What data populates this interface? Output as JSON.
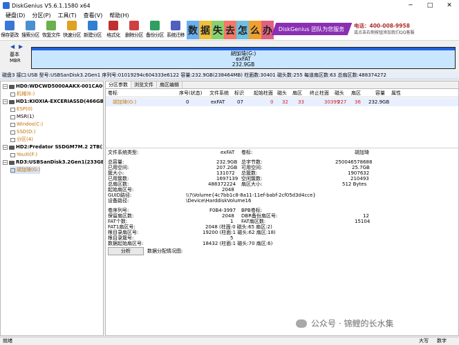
{
  "window": {
    "title": "DiskGenius V5.6.1.1580 x64",
    "minimize": "─",
    "maximize": "□",
    "close": "✕"
  },
  "menu": [
    "硬盘(D)",
    "分区(P)",
    "工具(T)",
    "查看(V)",
    "帮助(H)"
  ],
  "toolbar": [
    {
      "label": "保存更改",
      "icon": "save-icon",
      "color": "#3a78d8"
    },
    {
      "label": "搜索分区",
      "icon": "search-partition-icon",
      "color": "#4a90d0"
    },
    {
      "label": "恢复文件",
      "icon": "recover-files-icon",
      "color": "#6ab04c"
    },
    {
      "label": "快速分区",
      "icon": "quick-partition-icon",
      "color": "#e0a020"
    },
    {
      "label": "新建分区",
      "icon": "new-partition-icon",
      "color": "#2f80d0"
    },
    {
      "label": "格式化",
      "icon": "format-icon",
      "color": "#c03030"
    },
    {
      "label": "删除分区",
      "icon": "delete-partition-icon",
      "color": "#d04040"
    },
    {
      "label": "备份分区",
      "icon": "backup-partition-icon",
      "color": "#30a060"
    },
    {
      "label": "系统迁移",
      "icon": "system-migration-icon",
      "color": "#5060c0"
    }
  ],
  "banner": {
    "tiles": [
      {
        "char": "数",
        "color": "#6ab0f0"
      },
      {
        "char": "据",
        "color": "#f0c040"
      },
      {
        "char": "失",
        "color": "#8ad070"
      },
      {
        "char": "去",
        "color": "#f07a6a"
      },
      {
        "char": "怎",
        "color": "#70c0e0"
      },
      {
        "char": "么",
        "color": "#f0a030"
      },
      {
        "char": "办",
        "color": "#e06080"
      }
    ],
    "promo": "DiskGenius 团队为您服务",
    "phone": "电话：400-008-9958",
    "qq": "或点击右侧按钮添加我们QQ客服"
  },
  "diskmap": {
    "left_arrow": "◀",
    "right_arrow": "▶",
    "basic": "基本",
    "mbr": "MBR",
    "partition_name": "胡加琦(G:)",
    "partition_fs": "exFAT",
    "partition_size": "232.9GB"
  },
  "info_line": "磁盘3 接口:USB  型号:USBSanDisk3.2Gen1  序列号:01019294c604333e6122  容量:232.9GB(238464MB)  柱面数:30401  磁头数:255  每道扇区数:63  总扇区数:488374272",
  "tree": [
    {
      "label": "HD0:WDCWD5000AAKX-001CA0(466",
      "type": "disk",
      "bold": true
    },
    {
      "label": "机械(E:)",
      "type": "part"
    },
    {
      "label": "HD1:KIOXIA-EXCERIASSD(466GB)",
      "type": "disk",
      "bold": true
    },
    {
      "label": "ESP(0)",
      "type": "part"
    },
    {
      "label": "MSR(1)",
      "type": "part"
    },
    {
      "label": "Windos(C:)",
      "type": "part"
    },
    {
      "label": "SSD(D:)",
      "type": "part"
    },
    {
      "label": "分区(4)",
      "type": "part"
    },
    {
      "label": "HD2:Predator SSDGM7M.2 2TB(1908G",
      "type": "disk",
      "bold": true
    },
    {
      "label": "YouXi(F:)",
      "type": "part"
    },
    {
      "label": "RD3:USBSanDisk3.2Gen1(233GB)",
      "type": "disk",
      "bold": true
    },
    {
      "label": "胡加琦(G:)",
      "type": "part"
    }
  ],
  "tabs": [
    "分区参数",
    "浏览文件",
    "扇区编辑"
  ],
  "table": {
    "headers": [
      "卷标",
      "序号(状态)",
      "文件系统",
      "标识",
      "起始柱面",
      "磁头",
      "扇区",
      "终止柱面",
      "磁头",
      "扇区",
      "容量",
      "属性"
    ],
    "row": [
      "胡加琦(G:)",
      "0",
      "exFAT",
      "07",
      "0",
      "32",
      "33",
      "30399",
      "227",
      "36",
      "232.9GB",
      ""
    ]
  },
  "props": {
    "fs_type_label": "文件系统类型:",
    "fs_type": "exFAT",
    "vol_label_label": "卷标:",
    "vol_label": "胡加琦",
    "total_capacity_label": "总容量:",
    "total_capacity": "232.9GB",
    "total_bytes_label": "总字节数:",
    "total_bytes": "250046578688",
    "used_label": "已用空间:",
    "used": "207.2GB",
    "free_label": "可用空间:",
    "free": "25.7GB",
    "cluster_size_label": "簇大小:",
    "cluster_size": "131072",
    "total_clusters_label": "总簇数:",
    "total_clusters": "1907632",
    "used_clusters_label": "已用簇数:",
    "used_clusters": "1697139",
    "free_clusters_label": "空闲簇数:",
    "free_clusters": "210493",
    "total_sectors_label": "总扇区数:",
    "total_sectors": "488372224",
    "sector_size_label": "扇区大小:",
    "sector_size": "512 Bytes",
    "start_sector_label": "起始扇区号:",
    "start_sector": "2048",
    "guid_path_label": "GUID路径:",
    "guid_path": "\\\\?\\Volume{4c7bb1c8-8a11-11ef-babf-2cf05d3d4cce}",
    "device_path_label": "设备路径:",
    "device_path": "\\Device\\HarddiskVolume16",
    "serial_label": "卷序列号:",
    "serial": "F0B4-3997",
    "bpb_label_label": "BPB卷标:",
    "bpb_label": "",
    "reserved_label": "保留扇区数:",
    "reserved": "2048",
    "dbr_backup_label": "DBR备份扇区号:",
    "dbr_backup": "12",
    "fat_count_label": "FAT个数:",
    "fat_count": "1",
    "fat_sectors_label": "FAT扇区数:",
    "fat_sectors": "15104",
    "fat1_label": "FAT1扇区号:",
    "fat1": "2048 (柱面:0 磁头:65 扇区:2)",
    "root_sector_label": "根目录扇区号:",
    "root_sector": "19200 (柱面:1 磁头:62 扇区:18)",
    "root_cluster_label": "根目录簇号:",
    "root_cluster": "5",
    "data_start_label": "数据起始扇区号:",
    "data_start": "18432 (柱面:1 磁头:70 扇区:6)",
    "analyze_button": "分析",
    "distribution_label": "数据分配情况图:"
  },
  "statusbar": {
    "left": "就绪",
    "caps": "大写",
    "num": "数字"
  },
  "watermark": "公众号 · 锦鲤的长水集"
}
